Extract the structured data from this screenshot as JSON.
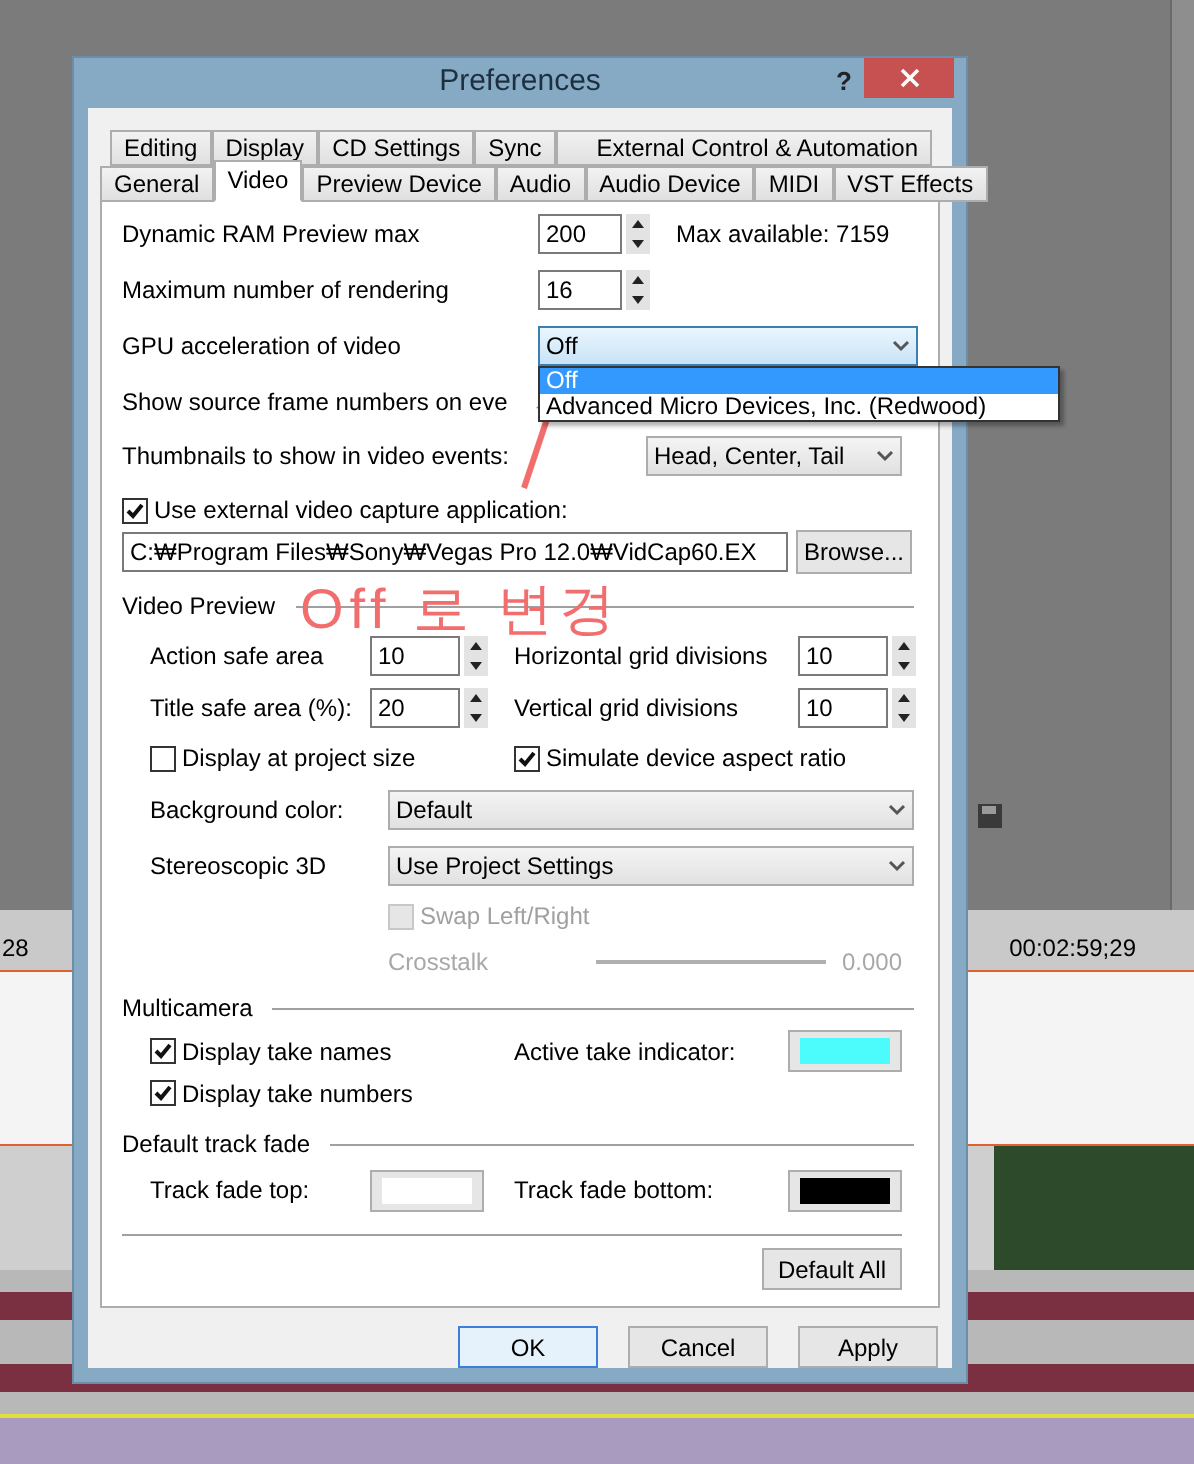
{
  "window": {
    "title": "Preferences",
    "help": "?"
  },
  "tabs_row_1": [
    {
      "label": "Editing",
      "selected": false
    },
    {
      "label": "Display",
      "selected": false
    },
    {
      "label": "CD Settings",
      "selected": false
    },
    {
      "label": "Sync",
      "selected": false
    },
    {
      "label": "External Control & Automation",
      "selected": false
    }
  ],
  "tabs_row_2": [
    {
      "label": "General",
      "selected": false
    },
    {
      "label": "Video",
      "selected": true
    },
    {
      "label": "Preview Device",
      "selected": false
    },
    {
      "label": "Audio",
      "selected": false
    },
    {
      "label": "Audio Device",
      "selected": false
    },
    {
      "label": "MIDI",
      "selected": false
    },
    {
      "label": "VST Effects",
      "selected": false
    }
  ],
  "settings": [
    {
      "kind": "spin",
      "label": "Dynamic RAM Preview max",
      "value": "200",
      "note": "Max available: 7159"
    },
    {
      "kind": "spin",
      "label": "Maximum number of rendering",
      "value": "16"
    },
    {
      "kind": "dropdown",
      "label": "GPU acceleration of video",
      "value": "Off",
      "expanded": true,
      "options": [
        {
          "label": "Off",
          "selected": true
        },
        {
          "label": "Advanced Micro Devices, Inc. (Redwood)",
          "selected": false
        }
      ]
    },
    {
      "kind": "text",
      "label": "Show source frame numbers on eve"
    },
    {
      "kind": "select",
      "label": "Thumbnails to show in video events:",
      "value": "Head, Center, Tail"
    }
  ],
  "capture": {
    "label": "Use external video capture application:",
    "checked": true,
    "path": "C:₩Program Files₩Sony₩Vegas Pro 12.0₩VidCap60.EX",
    "button": "Browse..."
  },
  "video_preview": {
    "title": "Video Preview",
    "fields": [
      {
        "label": "Action safe area",
        "value": "10"
      },
      {
        "label": "Horizontal grid divisions",
        "value": "10"
      },
      {
        "label": "Title safe area (%):",
        "value": "20"
      },
      {
        "label": "Vertical grid divisions",
        "value": "10"
      }
    ],
    "checks": [
      {
        "label": "Display at project size",
        "checked": false
      },
      {
        "label": "Simulate device aspect ratio",
        "checked": true
      }
    ],
    "selects": [
      {
        "label": "Background color:",
        "value": "Default"
      },
      {
        "label": "Stereoscopic 3D",
        "value": "Use Project Settings"
      }
    ],
    "swap": {
      "label": "Swap Left/Right",
      "checked": false,
      "disabled": true
    },
    "crosstalk": {
      "label": "Crosstalk",
      "reading": "0.000",
      "disabled": true
    }
  },
  "multicamera": {
    "title": "Multicamera",
    "checks": [
      {
        "label": "Display take names",
        "checked": true
      },
      {
        "label": "Display take numbers",
        "checked": true
      }
    ],
    "indicator": {
      "label": "Active take indicator:",
      "color": "#4cfcfc"
    }
  },
  "track_fade": {
    "title": "Default track fade",
    "swatches": [
      {
        "label": "Track fade top:",
        "color": "#ffffff"
      },
      {
        "label": "Track fade bottom:",
        "color": "#000000"
      }
    ]
  },
  "default_all": "Default All",
  "buttons": [
    {
      "label": "OK",
      "focused": true
    },
    {
      "label": "Cancel",
      "focused": false
    },
    {
      "label": "Apply",
      "focused": false
    }
  ],
  "annotation": {
    "text": "Off 로 변경"
  },
  "timeline": {
    "left_time": "28",
    "right_time": "00:02:59;29"
  }
}
